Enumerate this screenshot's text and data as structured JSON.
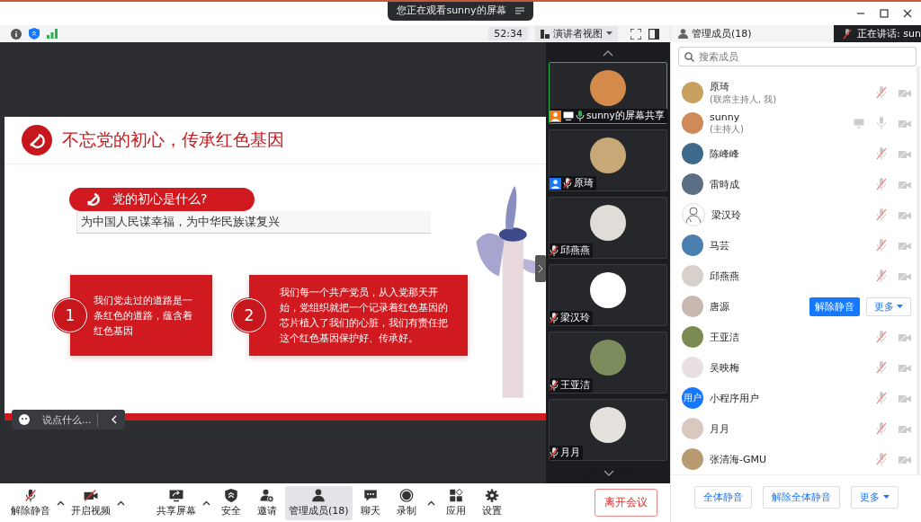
{
  "banner": {
    "text": "您正在观看sunny的屏幕"
  },
  "window_controls": [
    {
      "kind": "minimize"
    },
    {
      "kind": "maximize"
    },
    {
      "kind": "close"
    }
  ],
  "toolbar": {
    "timer": "52:34",
    "view_mode": "演讲者视图"
  },
  "panel_header": {
    "title": "管理成员(18)",
    "speaking": "正在讲话: sun"
  },
  "slide": {
    "title": "不忘党的初心，传承红色基因",
    "question": "党的初心是什么?",
    "answer": "为中国人民谋幸福，为中华民族谋复兴",
    "points": [
      {
        "number": "1",
        "text": "我们党走过的道路是一条红色的道路，蕴含着红色基因"
      },
      {
        "number": "2",
        "text": "我们每一个共产党员，从入党那天开始，党组织就把一个记录着红色基因的芯片植入了我们的心脏，我们有责任把这个红色基因保护好、传承好。"
      }
    ]
  },
  "chat": {
    "placeholder": "说点什么..."
  },
  "search": {
    "placeholder": "搜索成员"
  },
  "video_tiles": [
    {
      "name": "sunny的屏幕共享",
      "kind": "host",
      "sharing": true,
      "muted": false,
      "selected": true
    },
    {
      "name": "原琦",
      "kind": "cohost",
      "sharing": false,
      "muted": true,
      "selected": false
    },
    {
      "name": "邱燕燕",
      "sharing": false,
      "muted": true,
      "selected": false
    },
    {
      "name": "梁汉玲",
      "sharing": false,
      "muted": true,
      "selected": false
    },
    {
      "name": "王亚洁",
      "sharing": false,
      "muted": true,
      "selected": false
    },
    {
      "name": "月月",
      "sharing": false,
      "muted": true,
      "selected": false
    }
  ],
  "members": [
    {
      "name": "原琦",
      "role": "(联席主持人, 我)",
      "kind": "photo",
      "muted": true,
      "sharing": false
    },
    {
      "name": "sunny",
      "role": "(主持人)",
      "kind": "photo",
      "muted": false,
      "sharing": true
    },
    {
      "name": "陈峰峰",
      "kind": "photo",
      "muted": true,
      "sharing": false
    },
    {
      "name": "雷時成",
      "kind": "photo",
      "muted": true,
      "sharing": false
    },
    {
      "name": "梁汉玲",
      "kind": "sketch",
      "muted": true,
      "sharing": false
    },
    {
      "name": "马芸",
      "kind": "photo",
      "muted": true,
      "sharing": false
    },
    {
      "name": "邱燕燕",
      "kind": "photo",
      "muted": true,
      "sharing": false
    },
    {
      "name": "唐源",
      "kind": "photo",
      "actions": [
        "解除静音",
        "更多"
      ]
    },
    {
      "name": "王亚洁",
      "kind": "photo",
      "muted": true,
      "sharing": false
    },
    {
      "name": "吴映梅",
      "kind": "photo",
      "muted": true,
      "sharing": false
    },
    {
      "name": "小程序用户",
      "kind": "text",
      "avatar_text": "用户",
      "muted": true,
      "sharing": false
    },
    {
      "name": "月月",
      "kind": "photo",
      "muted": true,
      "sharing": false
    },
    {
      "name": "张清海-GMU",
      "kind": "photo",
      "muted": true,
      "sharing": false
    }
  ],
  "member_actions": [
    "全体静音",
    "解除全体静音",
    "更多"
  ],
  "controls": [
    {
      "label": "解除静音",
      "kind": "mic-off",
      "menu": true,
      "selected": false
    },
    {
      "label": "开启视频",
      "kind": "camera-off",
      "menu": true,
      "selected": false
    },
    {
      "label": "共享屏幕",
      "kind": "share",
      "menu": true,
      "selected": false
    },
    {
      "label": "安全",
      "kind": "shield",
      "menu": false,
      "selected": false
    },
    {
      "label": "邀请",
      "kind": "invite",
      "menu": false,
      "selected": false
    },
    {
      "label": "管理成员(18)",
      "kind": "members",
      "menu": false,
      "selected": true
    },
    {
      "label": "聊天",
      "kind": "chat",
      "menu": false,
      "selected": false
    },
    {
      "label": "录制",
      "kind": "record",
      "menu": true,
      "selected": false
    },
    {
      "label": "应用",
      "kind": "apps",
      "menu": false,
      "selected": false
    },
    {
      "label": "设置",
      "kind": "settings",
      "menu": false,
      "selected": false
    }
  ],
  "leave": {
    "label": "离开会议"
  }
}
